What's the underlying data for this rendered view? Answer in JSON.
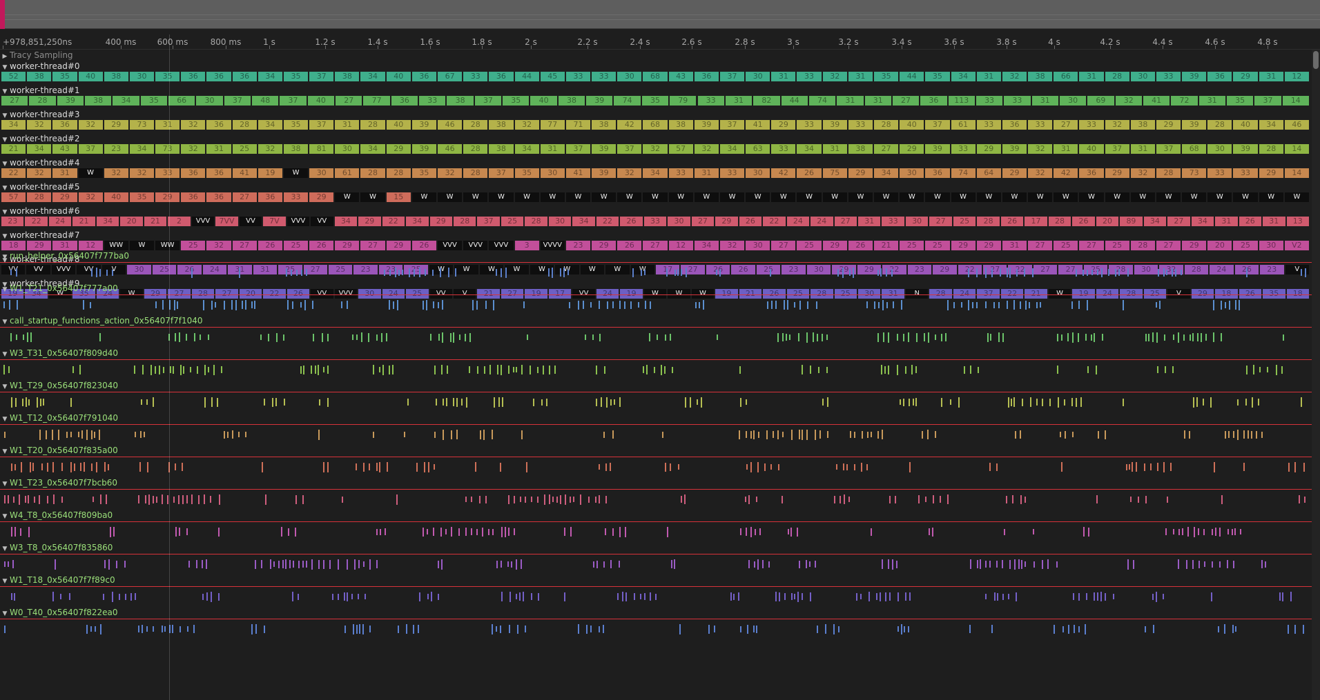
{
  "ruler": {
    "labels": [
      "+978,851,250ns",
      "400 ms",
      "600 ms",
      "800 ms",
      "1 s",
      "1.2 s",
      "1.4 s",
      "1.6 s",
      "1.8 s",
      "2 s",
      "2.2 s",
      "2.4 s",
      "2.6 s",
      "2.8 s",
      "3 s",
      "3.2 s",
      "3.4 s",
      "3.6 s",
      "3.8 s",
      "4 s",
      "4.2 s",
      "4.4 s",
      "4.6 s",
      "4.8 s"
    ]
  },
  "sampling": {
    "label": "Tracy Sampling",
    "icon": "triangle-right-icon"
  },
  "threads": [
    {
      "name": "worker-thread#0",
      "color": "#3faf8c",
      "zones": [
        "52",
        "38",
        "35",
        "40",
        "38",
        "30",
        "35",
        "36",
        "36",
        "36",
        "34",
        "35",
        "37",
        "38",
        "34",
        "40",
        "36",
        "67",
        "33",
        "36",
        "44",
        "45",
        "33",
        "33",
        "30",
        "68",
        "43",
        "36",
        "37",
        "30",
        "31",
        "33",
        "32",
        "31",
        "35",
        "44",
        "35",
        "34",
        "31",
        "32",
        "38",
        "66",
        "31",
        "28",
        "30",
        "33",
        "39",
        "36",
        "29",
        "31",
        "12"
      ]
    },
    {
      "name": "worker-thread#1",
      "color": "#5fb35a",
      "zones": [
        "27",
        "28",
        "39",
        "38",
        "34",
        "35",
        "66",
        "30",
        "37",
        "48",
        "37",
        "40",
        "27",
        "77",
        "36",
        "33",
        "38",
        "37",
        "35",
        "40",
        "38",
        "39",
        "74",
        "35",
        "79",
        "33",
        "31",
        "82",
        "44",
        "74",
        "31",
        "31",
        "27",
        "36",
        "113",
        "33",
        "33",
        "31",
        "30",
        "69",
        "32",
        "41",
        "72",
        "31",
        "35",
        "37",
        "14"
      ]
    },
    {
      "name": "worker-thread#3",
      "color": "#b4b24a",
      "zones": [
        "34",
        "32",
        "36",
        "32",
        "29",
        "73",
        "31",
        "32",
        "36",
        "28",
        "34",
        "35",
        "37",
        "31",
        "28",
        "40",
        "39",
        "46",
        "28",
        "38",
        "32",
        "77",
        "71",
        "38",
        "42",
        "68",
        "38",
        "39",
        "37",
        "41",
        "29",
        "33",
        "39",
        "33",
        "28",
        "40",
        "37",
        "61",
        "33",
        "36",
        "33",
        "27",
        "33",
        "32",
        "38",
        "29",
        "39",
        "28",
        "40",
        "34",
        "46"
      ]
    },
    {
      "name": "worker-thread#2",
      "color": "#8fb644",
      "zones": [
        "21",
        "34",
        "43",
        "37",
        "23",
        "34",
        "73",
        "32",
        "31",
        "25",
        "32",
        "38",
        "81",
        "30",
        "34",
        "29",
        "39",
        "46",
        "28",
        "38",
        "34",
        "31",
        "37",
        "39",
        "37",
        "32",
        "57",
        "32",
        "34",
        "63",
        "33",
        "34",
        "31",
        "38",
        "27",
        "29",
        "39",
        "33",
        "29",
        "39",
        "32",
        "31",
        "40",
        "37",
        "31",
        "37",
        "68",
        "30",
        "39",
        "28",
        "14"
      ]
    },
    {
      "name": "worker-thread#4",
      "color": "#c7884f",
      "zones": [
        "22",
        "32",
        "31",
        "W",
        "32",
        "32",
        "33",
        "36",
        "36",
        "41",
        "19",
        "W",
        "30",
        "61",
        "28",
        "28",
        "35",
        "32",
        "28",
        "37",
        "35",
        "30",
        "41",
        "39",
        "32",
        "34",
        "33",
        "31",
        "33",
        "30",
        "42",
        "26",
        "75",
        "29",
        "34",
        "30",
        "36",
        "74",
        "64",
        "29",
        "32",
        "42",
        "36",
        "29",
        "32",
        "28",
        "73",
        "33",
        "33",
        "29",
        "14"
      ]
    },
    {
      "name": "worker-thread#5",
      "color": "#cf6c5b",
      "zones": [
        "57",
        "28",
        "29",
        "32",
        "40",
        "35",
        "29",
        "36",
        "36",
        "27",
        "36",
        "33",
        "29",
        "W",
        "W",
        "15",
        "W",
        "W",
        "W",
        "W",
        "W",
        "W",
        "W",
        "W",
        "W",
        "W",
        "W",
        "W",
        "W",
        "W",
        "W",
        "W",
        "W",
        "W",
        "W",
        "W",
        "W",
        "W",
        "W",
        "W",
        "W",
        "W",
        "W",
        "W",
        "W",
        "W",
        "W",
        "W",
        "W",
        "W",
        "W"
      ]
    },
    {
      "name": "worker-thread#6",
      "color": "#d05a6e",
      "zones": [
        "23",
        "22",
        "24",
        "21",
        "34",
        "20",
        "21",
        "2",
        "VVV",
        "7VV",
        "VV",
        "7V",
        "VVV",
        "VV",
        "34",
        "29",
        "22",
        "34",
        "29",
        "28",
        "37",
        "25",
        "28",
        "30",
        "34",
        "22",
        "26",
        "33",
        "30",
        "27",
        "29",
        "26",
        "22",
        "24",
        "24",
        "27",
        "31",
        "33",
        "30",
        "27",
        "25",
        "28",
        "26",
        "17",
        "28",
        "26",
        "20",
        "89",
        "34",
        "27",
        "34",
        "31",
        "26",
        "31",
        "13"
      ]
    },
    {
      "name": "worker-thread#7",
      "color": "#c24f9a",
      "zones": [
        "18",
        "29",
        "31",
        "12",
        "WW",
        "W",
        "WW",
        "25",
        "32",
        "27",
        "26",
        "25",
        "26",
        "29",
        "27",
        "29",
        "26",
        "VVV",
        "VVV",
        "VVV",
        "3",
        "VVVV",
        "23",
        "29",
        "26",
        "27",
        "12",
        "34",
        "32",
        "30",
        "27",
        "25",
        "29",
        "26",
        "21",
        "25",
        "25",
        "29",
        "29",
        "31",
        "27",
        "25",
        "27",
        "25",
        "28",
        "27",
        "29",
        "20",
        "25",
        "30",
        "V2"
      ]
    },
    {
      "name": "worker-thread#8",
      "color": "#9b55b9",
      "zones": [
        "VV",
        "VV",
        "VVV",
        "VV",
        "V",
        "30",
        "25",
        "26",
        "24",
        "31",
        "31",
        "25",
        "27",
        "25",
        "23",
        "23",
        "25",
        "W",
        "W",
        "W",
        "W",
        "W",
        "W",
        "W",
        "W",
        "W",
        "17",
        "27",
        "26",
        "26",
        "25",
        "23",
        "30",
        "29",
        "29",
        "22",
        "23",
        "29",
        "22",
        "27",
        "22",
        "27",
        "27",
        "25",
        "28",
        "30",
        "32",
        "28",
        "24",
        "26",
        "23",
        "V"
      ]
    },
    {
      "name": "worker-thread#9",
      "color": "#6d5fc4",
      "zones": [
        "19",
        "34",
        "W",
        "35",
        "24",
        "W",
        "29",
        "27",
        "28",
        "27",
        "20",
        "22",
        "26",
        "VV",
        "VVV",
        "30",
        "24",
        "25",
        "VV",
        "V",
        "21",
        "27",
        "19",
        "17",
        "VV",
        "24",
        "19",
        "W",
        "W",
        "W",
        "19",
        "21",
        "26",
        "25",
        "28",
        "25",
        "30",
        "31",
        "N",
        "28",
        "24",
        "37",
        "22",
        "21",
        "W",
        "19",
        "24",
        "28",
        "25",
        "V",
        "29",
        "18",
        "26",
        "35",
        "18"
      ]
    }
  ],
  "plots": [
    {
      "name": "run_helper_0x56407f777ba0",
      "color": "#5b7fc9"
    },
    {
      "name": "W1_T21_0x56407f777a00",
      "color": "#5b8fcf"
    },
    {
      "name": "call_startup_functions_action_0x56407f7f1040",
      "color": "#6cc46a"
    },
    {
      "name": "W3_T31_0x56407f809d40",
      "color": "#8cc24f"
    },
    {
      "name": "W1_T29_0x56407f823040",
      "color": "#b6bf52"
    },
    {
      "name": "W1_T12_0x56407f791040",
      "color": "#c99a5b"
    },
    {
      "name": "W1_T20_0x56407f835a00",
      "color": "#cf7058"
    },
    {
      "name": "W1_T23_0x56407f7bcb60",
      "color": "#cf5e7e"
    },
    {
      "name": "W4_T8_0x56407f809ba0",
      "color": "#c25ab0"
    },
    {
      "name": "W3_T8_0x56407f835860",
      "color": "#9b5cc6"
    },
    {
      "name": "W1_T18_0x56407f7f89c0",
      "color": "#7460c8"
    },
    {
      "name": "W0_T40_0x56407f822ea0",
      "color": "#5b7fcf"
    }
  ]
}
